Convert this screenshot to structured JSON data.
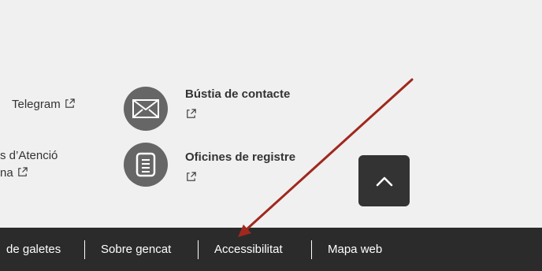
{
  "links": {
    "telegram": {
      "label": "Telegram"
    },
    "atencio": {
      "line1": "s d’Atenció",
      "line2": "na"
    },
    "bustia": {
      "label": "Bústia de contacte",
      "icon": "envelope-icon"
    },
    "oficines": {
      "label": "Oficines de registre",
      "icon": "document-icon"
    }
  },
  "back_to_top": {
    "icon": "chevron-up-icon"
  },
  "footer": {
    "items": [
      {
        "label": "de galetes"
      },
      {
        "label": "Sobre gencat"
      },
      {
        "label": "Accessibilitat"
      },
      {
        "label": "Mapa web"
      }
    ]
  },
  "annotation": {
    "color": "#a0281e",
    "icon": "annotation-arrow"
  },
  "colors": {
    "background": "#f0f0f0",
    "footer": "#2b2b2b",
    "icon_circle": "#666666"
  }
}
